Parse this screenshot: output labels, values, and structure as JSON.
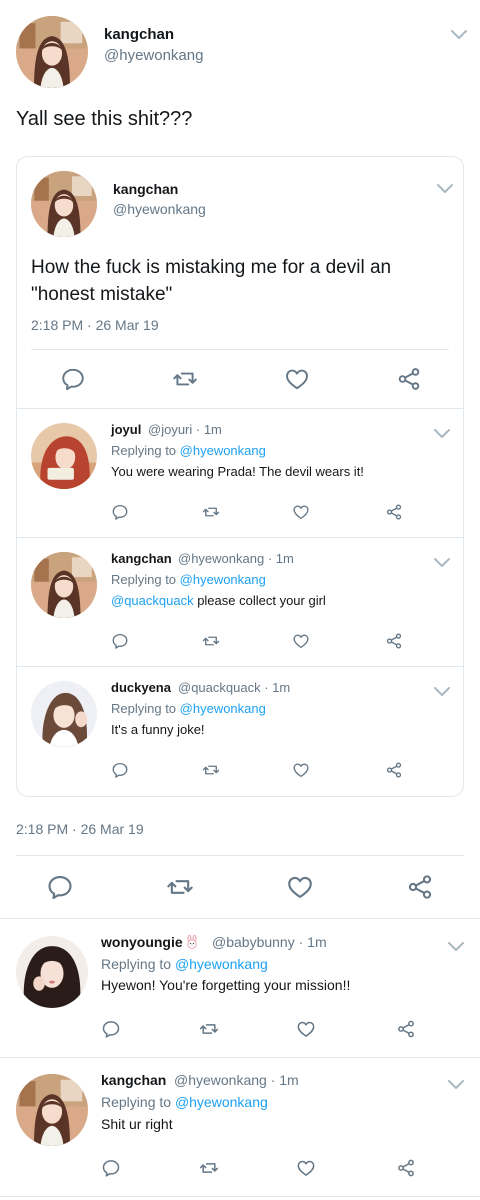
{
  "main": {
    "name": "kangchan",
    "handle": "@hyewonkang",
    "text": "Yall see this shit???",
    "timestamp": "2:18 PM · 26 Mar 19"
  },
  "quoted": {
    "name": "kangchan",
    "handle": "@hyewonkang",
    "text_line1": "How the fuck is mistaking me for a devil an",
    "text_line2": "\"honest mistake\"",
    "timestamp": "2:18 PM · 26 Mar 19",
    "replies": [
      {
        "name": "joyul",
        "handle": "@joyuri",
        "time": "· 1m",
        "replying_prefix": "Replying to ",
        "replying_to": "@hyewonkang",
        "text_mention": "",
        "text": "You were wearing Prada! The devil wears it!"
      },
      {
        "name": "kangchan",
        "handle": "@hyewonkang",
        "time": "· 1m",
        "replying_prefix": "Replying to ",
        "replying_to": "@hyewonkang",
        "text_mention": "@quackquack",
        "text": " please collect your girl"
      },
      {
        "name": "duckyena",
        "handle": "@quackquack",
        "time": "· 1m",
        "replying_prefix": "Replying to ",
        "replying_to": "@hyewonkang",
        "text_mention": "",
        "text": "It's a funny joke!"
      }
    ]
  },
  "replies": [
    {
      "name": "wonyoungie",
      "handle": "@babybunny",
      "time": "· 1m",
      "replying_prefix": "Replying to ",
      "replying_to": "@hyewonkang",
      "text": "Hyewon! You're forgetting your mission!!",
      "emoji_icon": "bunny-emoji"
    },
    {
      "name": "kangchan",
      "handle": "@hyewonkang",
      "time": "· 1m",
      "replying_prefix": "Replying to ",
      "replying_to": "@hyewonkang",
      "text": "Shit ur right"
    }
  ],
  "icons": {
    "reply": "reply-icon",
    "retweet": "retweet-icon",
    "like": "heart-icon",
    "share": "share-icon",
    "more": "chevron-down-icon"
  },
  "colors": {
    "link": "#1da1f2",
    "muted": "#657786",
    "text": "#14171a",
    "border": "#e1e8ed"
  }
}
